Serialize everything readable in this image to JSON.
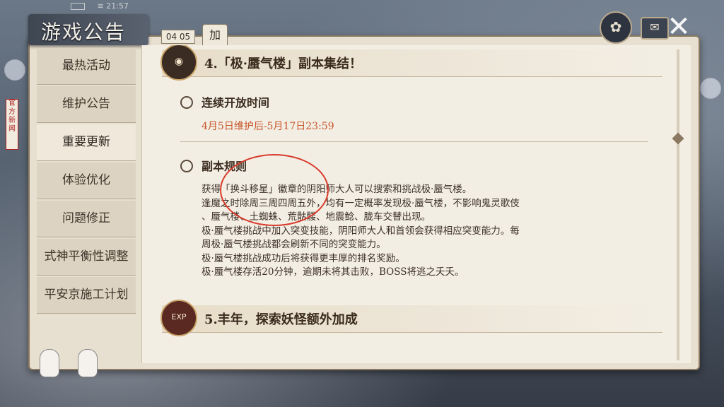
{
  "status_bar": {
    "time": "21:57"
  },
  "window": {
    "title": "游戏公告"
  },
  "page_indicator": "04 05",
  "page_tab": "加",
  "top_buttons": {
    "close": "✕"
  },
  "sidebar": {
    "items": [
      {
        "label": "最热活动"
      },
      {
        "label": "维护公告"
      },
      {
        "label": "重要更新",
        "active": true
      },
      {
        "label": "体验优化"
      },
      {
        "label": "问题修正"
      },
      {
        "label": "式神平衡性调整"
      },
      {
        "label": "平安京施工计划"
      }
    ]
  },
  "side_tag": "官方新闻",
  "content": {
    "section4": {
      "title": "4.「极·蜃气楼」副本集结！",
      "open_time_label": "连续开放时间",
      "open_time_value": "4月5日维护后-5月17日23:59",
      "rules_label": "副本规则",
      "rules_lines": [
        "获得「换斗移星」徽章的阴阳师大人可以搜索和挑战极·蜃气楼。",
        "逢魔之时除周三周四周五外，均有一定概率发现极·蜃气楼，不影响鬼灵歌伎",
        "、蜃气楼、土蜘蛛、荒骷髅、地震鲶、胧车交替出现。",
        "极·蜃气楼挑战中加入突变技能，阴阳师大人和首领会获得相应突变能力。每",
        "周极·蜃气楼挑战都会刷新不同的突变能力。",
        "极·蜃气楼挑战成功后将获得更丰厚的排名奖励。",
        "极·蜃气楼存活20分钟，逾期未将其击败，BOSS将逃之夭夭。"
      ]
    },
    "section5": {
      "title": "5.丰年，探索妖怪额外加成",
      "icon_text": "EXP"
    }
  },
  "colors": {
    "date": "#c8552a",
    "annotation": "#d83a2a"
  }
}
